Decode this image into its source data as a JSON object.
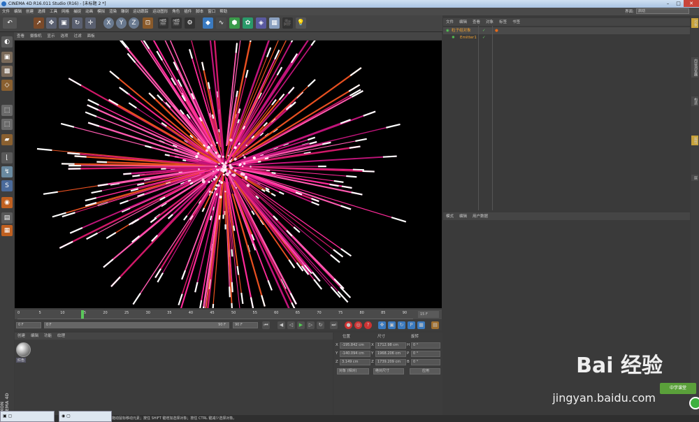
{
  "app": {
    "title": "CINEMA 4D R16.011 Studio (R16) - [未标题 2 *]"
  },
  "menubar": [
    "文件",
    "编辑",
    "创建",
    "选择",
    "工具",
    "网格",
    "捕捉",
    "动画",
    "模拟",
    "渲染",
    "雕刻",
    "运动跟踪",
    "运动图形",
    "角色",
    "插件",
    "脚本",
    "窗口",
    "帮助"
  ],
  "interface": {
    "label": "界面:",
    "value": "启动"
  },
  "viewport_menu": [
    "查看",
    "摄像机",
    "显示",
    "选项",
    "过滤",
    "面板"
  ],
  "timeline": {
    "ticks": [
      "0",
      "5",
      "10",
      "15",
      "20",
      "25",
      "30",
      "35",
      "40",
      "45",
      "50",
      "55",
      "60",
      "65",
      "70",
      "75",
      "80",
      "85",
      "90"
    ],
    "end_field": "15 F",
    "current_frame": 15,
    "max_frame": 90
  },
  "transport": {
    "start": "0 F",
    "range_start": "0 F",
    "range_end": "90 F",
    "end": "90 F"
  },
  "material_panel": {
    "menu": [
      "创建",
      "编辑",
      "功能",
      "纹理"
    ],
    "material_label": "红色"
  },
  "coordinates": {
    "headers": {
      "position": "位置",
      "size": "尺寸",
      "rotation": "旋转"
    },
    "rows": [
      {
        "axis": "X",
        "pos": "-195.842 cm",
        "size_axis": "X",
        "size": "1712.98 cm",
        "rot_axis": "H",
        "rot": "0 °"
      },
      {
        "axis": "Y",
        "pos": "-140.094 cm",
        "size_axis": "Y",
        "size": "1968.206 cm",
        "rot_axis": "P",
        "rot": "0 °"
      },
      {
        "axis": "Z",
        "pos": "3.149 cm",
        "size_axis": "Z",
        "size": "1739.209 cm",
        "rot_axis": "B",
        "rot": "0 °"
      }
    ],
    "mode_select": "对象 (相对)",
    "size_select": "绝对尺寸",
    "apply_button": "应用"
  },
  "object_manager": {
    "menu": [
      "文件",
      "编辑",
      "查看",
      "对象",
      "标签",
      "书签"
    ],
    "objects": [
      {
        "name": "粒子组对象",
        "color": "#f0a030"
      },
      {
        "name": "Emitter1",
        "color": "#f0a030"
      }
    ]
  },
  "attribute_manager": {
    "menu": [
      "模式",
      "编辑",
      "用户数据"
    ]
  },
  "right_tabs": [
    "对象",
    "内容浏览器",
    "构造",
    "属性",
    "层"
  ],
  "maxon": "MAXON CINEMA 4D",
  "statusbar": "移动：点击并拖动鼠标移动元素；按住 SHIFT 键增加选择对象；按住 CTRL 键减少选择对象。",
  "watermark": {
    "main": "Bai 经验",
    "sub": "jingyan.baidu.com",
    "badge": "中学课堂"
  },
  "colors": {
    "accent": "#f0a030",
    "streak_magenta": "#c0147a",
    "streak_pink": "#ff2a9a",
    "streak_orange": "#e85020"
  }
}
